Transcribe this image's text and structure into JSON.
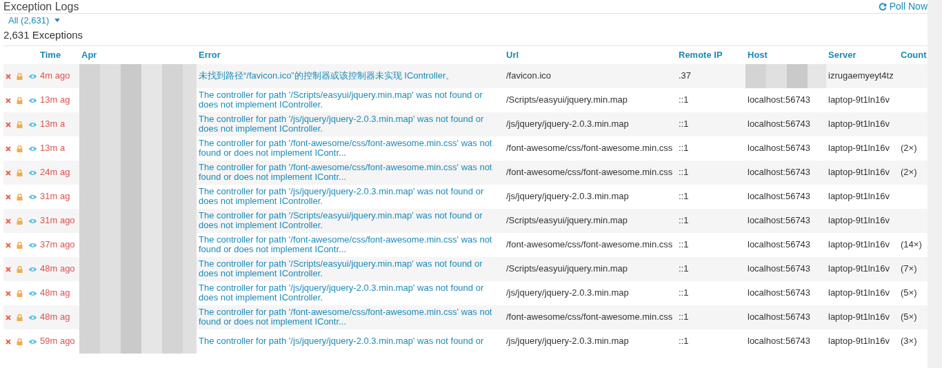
{
  "title": "Exception Logs",
  "poll_button": "Poll Now",
  "filter": {
    "label": "All (2,631)"
  },
  "summary": "2,631 Exceptions",
  "columns": [
    "Time",
    "Apr",
    "Error",
    "Url",
    "Remote IP",
    "Host",
    "Server",
    "Count"
  ],
  "rows": [
    {
      "time": "4m ago",
      "error": "未找到路径“/favicon.ico”的控制器或该控制器未实现 IController。",
      "url": "/favicon.ico",
      "remote_ip": ".37",
      "host": "",
      "server": "izrugaemyeyt4tz",
      "count": ""
    },
    {
      "time": "13m ag",
      "error": "The controller for path '/Scripts/easyui/jquery.min.map' was not found or does not implement IController.",
      "url": "/Scripts/easyui/jquery.min.map",
      "remote_ip": "::1",
      "host": "localhost:56743",
      "server": "laptop-9t1ln16v",
      "count": ""
    },
    {
      "time": "13m a",
      "error": "The controller for path '/js/jquery/jquery-2.0.3.min.map' was not found or does not implement IController.",
      "url": "/js/jquery/jquery-2.0.3.min.map",
      "remote_ip": "::1",
      "host": "localhost:56743",
      "server": "laptop-9t1ln16v",
      "count": ""
    },
    {
      "time": "13m a",
      "error": "The controller for path '/font-awesome/css/font-awesome.min.css' was not found or does not implement IContr...",
      "url": "/font-awesome/css/font-awesome.min.css",
      "remote_ip": "::1",
      "host": "localhost:56743",
      "server": "laptop-9t1ln16v",
      "count": "(2×)"
    },
    {
      "time": "24m ag",
      "error": "The controller for path '/font-awesome/css/font-awesome.min.css' was not found or does not implement IContr...",
      "url": "/font-awesome/css/font-awesome.min.css",
      "remote_ip": "::1",
      "host": "localhost:56743",
      "server": "laptop-9t1ln16v",
      "count": "(2×)"
    },
    {
      "time": "31m ag",
      "error": "The controller for path '/js/jquery/jquery-2.0.3.min.map' was not found or does not implement IController.",
      "url": "/js/jquery/jquery-2.0.3.min.map",
      "remote_ip": "::1",
      "host": "localhost:56743",
      "server": "laptop-9t1ln16v",
      "count": ""
    },
    {
      "time": "31m ago",
      "error": "The controller for path '/Scripts/easyui/jquery.min.map' was not found or does not implement IController.",
      "url": "/Scripts/easyui/jquery.min.map",
      "remote_ip": "::1",
      "host": "localhost:56743",
      "server": "laptop-9t1ln16v",
      "count": ""
    },
    {
      "time": "37m ago",
      "error": "The controller for path '/font-awesome/css/font-awesome.min.css' was not found or does not implement IContr...",
      "url": "/font-awesome/css/font-awesome.min.css",
      "remote_ip": "::1",
      "host": "localhost:56743",
      "server": "laptop-9t1ln16v",
      "count": "(14×)"
    },
    {
      "time": "48m ago",
      "error": "The controller for path '/Scripts/easyui/jquery.min.map' was not found or does not implement IController.",
      "url": "/Scripts/easyui/jquery.min.map",
      "remote_ip": "::1",
      "host": "localhost:56743",
      "server": "laptop-9t1ln16v",
      "count": "(7×)"
    },
    {
      "time": "48m ag",
      "error": "The controller for path '/js/jquery/jquery-2.0.3.min.map' was not found or does not implement IController.",
      "url": "/js/jquery/jquery-2.0.3.min.map",
      "remote_ip": "::1",
      "host": "localhost:56743",
      "server": "laptop-9t1ln16v",
      "count": "(5×)"
    },
    {
      "time": "48m ag",
      "error": "The controller for path '/font-awesome/css/font-awesome.min.css' was not found or does not implement IContr...",
      "url": "/font-awesome/css/font-awesome.min.css",
      "remote_ip": "::1",
      "host": "localhost:56743",
      "server": "laptop-9t1ln16v",
      "count": "(5×)"
    },
    {
      "time": "59m ago",
      "error": "The controller for path '/js/jquery/jquery-2.0.3.min.map' was not found or",
      "url": "/js/jquery/jquery-2.0.3.min.map",
      "remote_ip": "::1",
      "host": "localhost:56743",
      "server": "laptop-9t1ln16v",
      "count": "(3×)"
    }
  ]
}
